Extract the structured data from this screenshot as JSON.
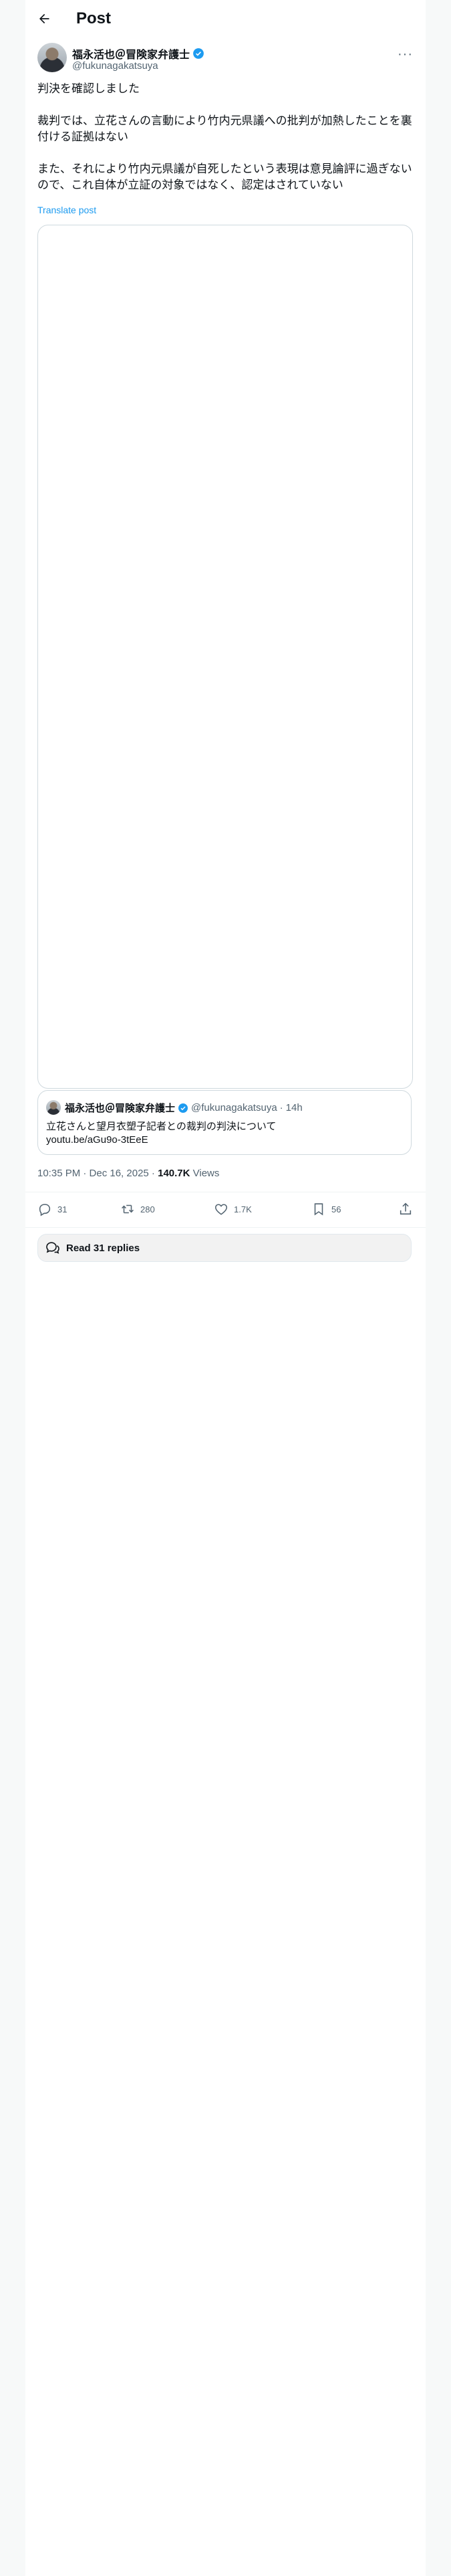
{
  "header": {
    "title": "Post",
    "back_icon": "arrow-left-icon"
  },
  "author": {
    "display_name": "福永活也＠冒険家弁護士",
    "handle": "@fukunagakatsuya",
    "verified_icon": "verified-badge-icon",
    "verified_color": "#1d9bf0",
    "more_icon": "more-dots-icon",
    "more_label": "···"
  },
  "post": {
    "paragraphs": [
      "判決を確認しました",
      "裁判では、立花さんの言動により竹内元県議への批判が加熱したことを裏付ける証拠はない",
      "また、それにより竹内元県議が自死したという表現は意見論評に過ぎないので、これ自体が立証の対象ではなく、認定はされていない"
    ],
    "translate_label": "Translate post"
  },
  "quote": {
    "display_name": "福永活也＠冒険家弁護士",
    "handle": "@fukunagakatsuya",
    "time": "14h",
    "text": "立花さんと望月衣塑子記者との裁判の判決について",
    "link": "youtu.be/aGu9o-3tEeE"
  },
  "meta": {
    "time": "10:35 PM · Dec 16, 2025 · ",
    "views_count": "140.7K",
    "views_label": " Views"
  },
  "actions": {
    "replies": "31",
    "reposts": "280",
    "likes": "1.7K",
    "bookmarks": "56"
  },
  "read_replies": {
    "label": "Read 31 replies",
    "icon": "speech-bubbles-icon"
  },
  "colors": {
    "accent": "#1d9bf0",
    "secondary_text": "#536471",
    "border": "#cfd9de"
  }
}
